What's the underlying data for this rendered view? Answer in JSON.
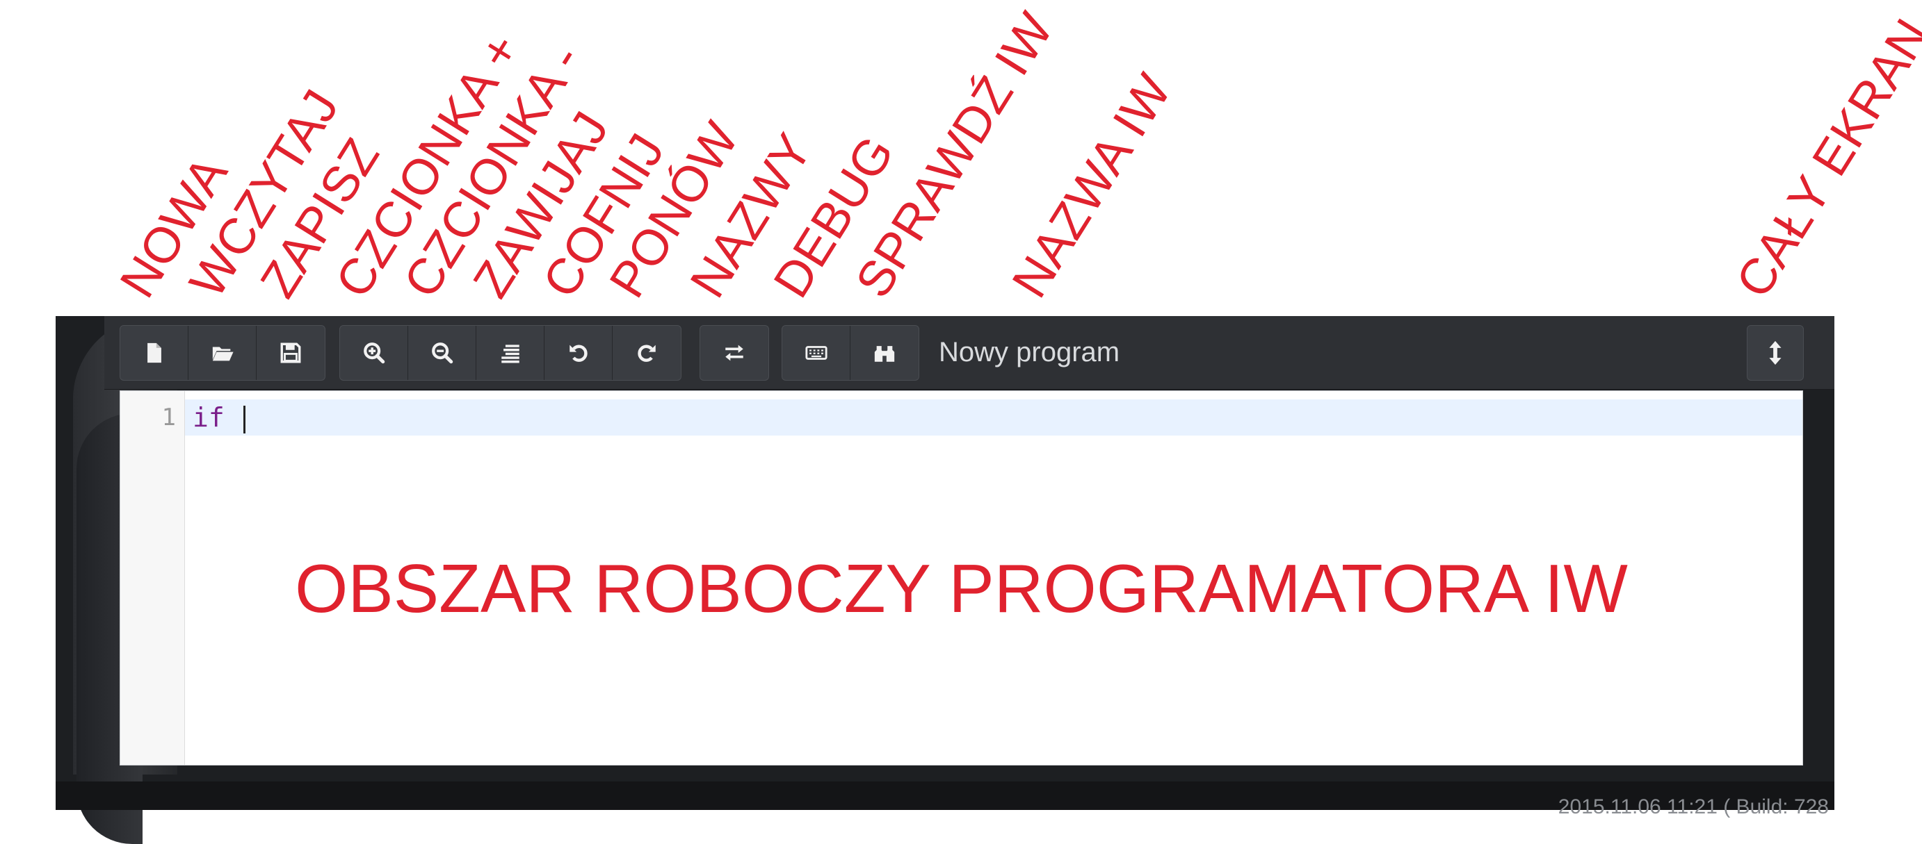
{
  "annotations": {
    "new": "NOWA",
    "open": "WCZYTAJ",
    "save": "ZAPISZ",
    "font_plus": "CZCIONKA +",
    "font_minus": "CZCIONKA -",
    "wrap": "ZAWIJAJ",
    "undo": "COFNIJ",
    "redo": "PONÓW",
    "names": "NAZWY",
    "debug": "DEBUG",
    "check": "SPRAWDŹ IW",
    "iw_name": "NAZWA IW",
    "fullscreen": "CAŁY EKRAN"
  },
  "toolbar": {
    "title": "Nowy program",
    "icons": {
      "new": "file-icon",
      "open": "folder-open-icon",
      "save": "save-icon",
      "zoom_in": "zoom-in-icon",
      "zoom_out": "zoom-out-icon",
      "wrap": "wrap-lines-icon",
      "undo": "undo-icon",
      "redo": "redo-icon",
      "names": "swap-icon",
      "debug": "keyboard-icon",
      "check": "binoculars-icon",
      "fullscreen": "vertical-arrows-icon"
    }
  },
  "editor": {
    "line_number": "1",
    "code": "if ",
    "workspace_label": "OBSZAR ROBOCZY PROGRAMATORA IW"
  },
  "status": {
    "text": "2015.11.06 11:21 ( Build: 728"
  },
  "colors": {
    "annotation": "#e0222e",
    "toolbar_bg": "#2e3034",
    "button_bg": "#3a3d42",
    "keyword": "#7a1f8a",
    "active_line": "#e8f2ff"
  }
}
